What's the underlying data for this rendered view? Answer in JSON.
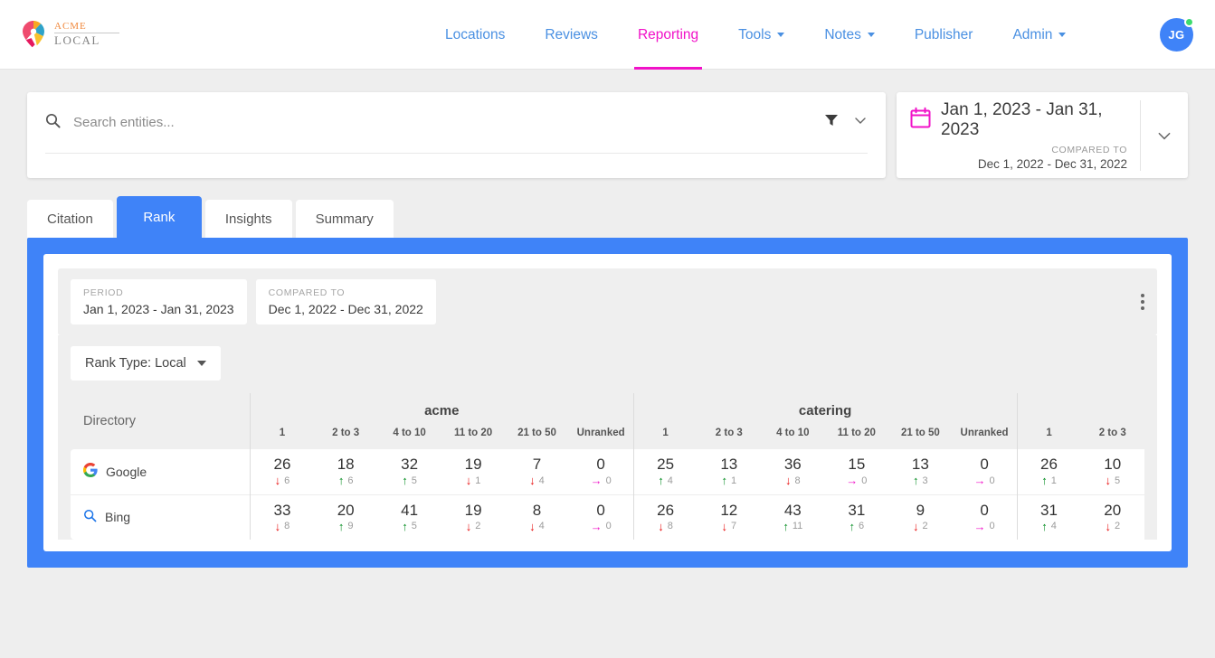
{
  "brand": {
    "name_top": "ACME",
    "name_bottom": "LOCAL"
  },
  "nav": {
    "items": [
      {
        "label": "Locations",
        "active": false,
        "dropdown": false
      },
      {
        "label": "Reviews",
        "active": false,
        "dropdown": false
      },
      {
        "label": "Reporting",
        "active": true,
        "dropdown": false
      },
      {
        "label": "Tools",
        "active": false,
        "dropdown": true
      },
      {
        "label": "Notes",
        "active": false,
        "dropdown": true
      },
      {
        "label": "Publisher",
        "active": false,
        "dropdown": false
      },
      {
        "label": "Admin",
        "active": false,
        "dropdown": true
      }
    ],
    "avatar_initials": "JG"
  },
  "search": {
    "placeholder": "Search entities...",
    "value": ""
  },
  "date_picker": {
    "range": "Jan 1, 2023 - Jan 31, 2023",
    "compared_label": "COMPARED TO",
    "compared_range": "Dec 1, 2022 - Dec 31, 2022"
  },
  "tabs": [
    {
      "label": "Citation",
      "active": false
    },
    {
      "label": "Rank",
      "active": true
    },
    {
      "label": "Insights",
      "active": false
    },
    {
      "label": "Summary",
      "active": false
    }
  ],
  "report": {
    "period_label": "PERIOD",
    "period_value": "Jan 1, 2023 - Jan 31, 2023",
    "compared_label": "COMPARED TO",
    "compared_value": "Dec 1, 2022 - Dec 31, 2022",
    "rank_type": "Rank Type: Local",
    "directory_header": "Directory",
    "groups": [
      {
        "title": "acme",
        "columns": [
          "1",
          "2 to 3",
          "4 to 10",
          "11 to 20",
          "21 to 50",
          "Unranked"
        ]
      },
      {
        "title": "catering",
        "columns": [
          "1",
          "2 to 3",
          "4 to 10",
          "11 to 20",
          "21 to 50",
          "Unranked"
        ]
      },
      {
        "title": "",
        "columns": [
          "1",
          "2 to 3"
        ]
      }
    ],
    "rows": [
      {
        "directory": "Google",
        "icon": "google-icon",
        "cells": [
          {
            "value": "26",
            "dir": "down",
            "delta": "6"
          },
          {
            "value": "18",
            "dir": "up",
            "delta": "6"
          },
          {
            "value": "32",
            "dir": "up",
            "delta": "5"
          },
          {
            "value": "19",
            "dir": "down",
            "delta": "1"
          },
          {
            "value": "7",
            "dir": "down",
            "delta": "4"
          },
          {
            "value": "0",
            "dir": "flat",
            "delta": "0"
          },
          {
            "value": "25",
            "dir": "up",
            "delta": "4"
          },
          {
            "value": "13",
            "dir": "up",
            "delta": "1"
          },
          {
            "value": "36",
            "dir": "down",
            "delta": "8"
          },
          {
            "value": "15",
            "dir": "flat",
            "delta": "0"
          },
          {
            "value": "13",
            "dir": "up",
            "delta": "3"
          },
          {
            "value": "0",
            "dir": "flat",
            "delta": "0"
          },
          {
            "value": "26",
            "dir": "up",
            "delta": "1"
          },
          {
            "value": "10",
            "dir": "down",
            "delta": "5"
          }
        ]
      },
      {
        "directory": "Bing",
        "icon": "bing-search-icon",
        "cells": [
          {
            "value": "33",
            "dir": "down",
            "delta": "8"
          },
          {
            "value": "20",
            "dir": "up",
            "delta": "9"
          },
          {
            "value": "41",
            "dir": "up",
            "delta": "5"
          },
          {
            "value": "19",
            "dir": "down",
            "delta": "2"
          },
          {
            "value": "8",
            "dir": "down",
            "delta": "4"
          },
          {
            "value": "0",
            "dir": "flat",
            "delta": "0"
          },
          {
            "value": "26",
            "dir": "down",
            "delta": "8"
          },
          {
            "value": "12",
            "dir": "down",
            "delta": "7"
          },
          {
            "value": "43",
            "dir": "up",
            "delta": "11"
          },
          {
            "value": "31",
            "dir": "up",
            "delta": "6"
          },
          {
            "value": "9",
            "dir": "down",
            "delta": "2"
          },
          {
            "value": "0",
            "dir": "flat",
            "delta": "0"
          },
          {
            "value": "31",
            "dir": "up",
            "delta": "4"
          },
          {
            "value": "20",
            "dir": "down",
            "delta": "2"
          }
        ]
      }
    ]
  },
  "colors": {
    "accent_blue": "#3f83f8",
    "accent_magenta": "#f112c8",
    "link_blue": "#4a90e2",
    "up_green": "#0a8f26",
    "down_red": "#e81010",
    "flat_magenta": "#f112c8"
  }
}
